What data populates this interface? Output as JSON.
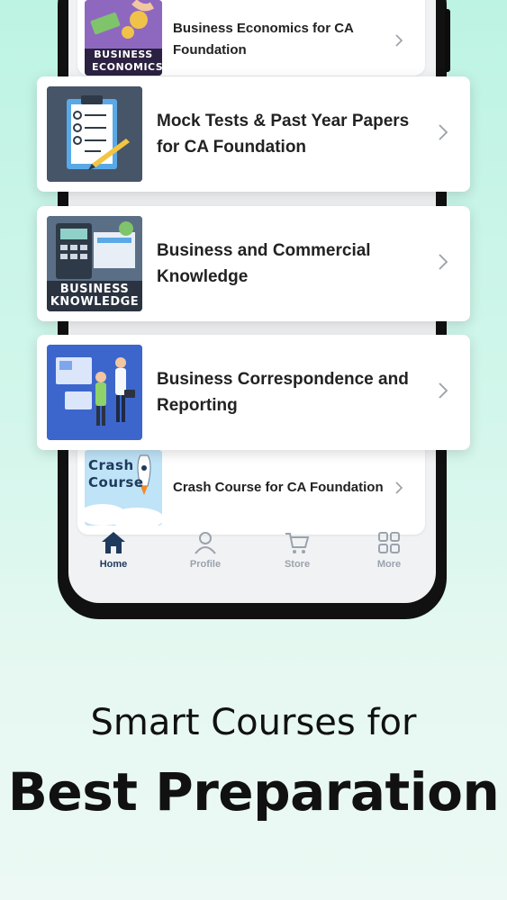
{
  "courses_behind": [
    {
      "title": "Business Economics for CA Foundation",
      "thumb_label": "BUSINESS ECONOMICS"
    },
    {
      "title": "Crash Course for CA Foundation",
      "thumb_label": "Crash Course"
    }
  ],
  "courses_featured": [
    {
      "title": "Mock Tests & Past Year Papers for CA Foundation"
    },
    {
      "title": "Business and Commercial Knowledge",
      "thumb_label": "BUSINESS KNOWLEDGE"
    },
    {
      "title": "Business Correspondence and Reporting"
    }
  ],
  "nav": [
    {
      "label": "Home",
      "icon": "home-icon",
      "active": true
    },
    {
      "label": "Profile",
      "icon": "profile-icon",
      "active": false
    },
    {
      "label": "Store",
      "icon": "cart-icon",
      "active": false
    },
    {
      "label": "More",
      "icon": "grid-icon",
      "active": false
    }
  ],
  "tagline": {
    "line1": "Smart Courses for",
    "line2": "Best Preparation"
  },
  "colors": {
    "accent": "#1e3a5c",
    "bg_top": "#bdf3e3",
    "bg_bottom": "#ecf9f4"
  }
}
